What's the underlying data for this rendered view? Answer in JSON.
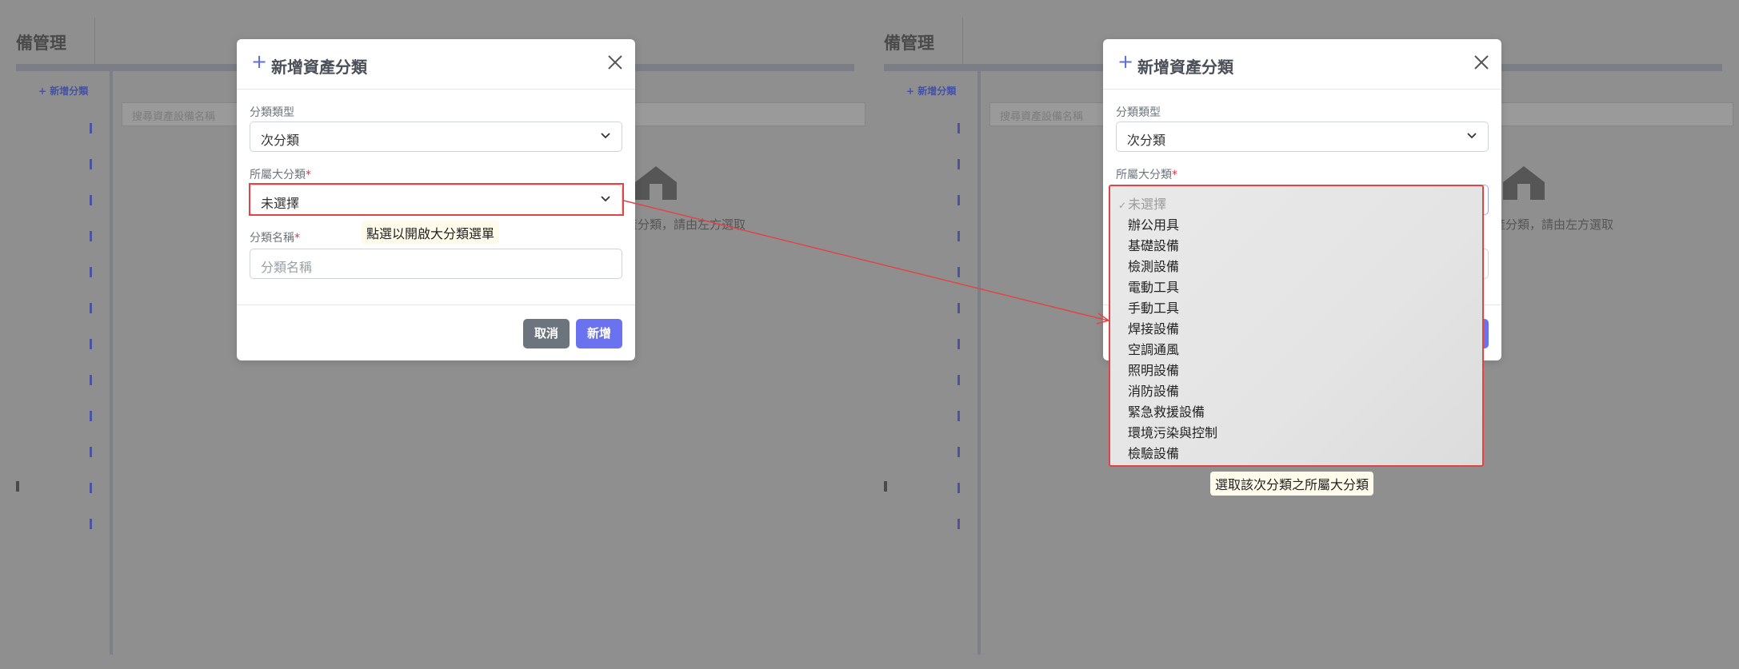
{
  "background_app": {
    "title": "備管理",
    "add_link": "+ 新增分類",
    "search_placeholder": "搜尋資產設備名稱",
    "empty_state_text": "產分類，請由左方選取"
  },
  "modal": {
    "title": "新增資產分類",
    "category_type_label": "分類類型",
    "category_type_value": "次分類",
    "parent_label": "所屬大分類",
    "parent_value": "未選擇",
    "name_label": "分類名稱",
    "name_placeholder": "分類名稱",
    "required_mark": "*",
    "cancel_label": "取消",
    "add_label": "新增"
  },
  "annotations": {
    "left_tooltip": "點選以開啟大分類選單",
    "right_tooltip": "選取該次分類之所屬大分類"
  },
  "dropdown": {
    "check_mark": "✓",
    "options": [
      "未選擇",
      "辦公用具",
      "基礎設備",
      "檢測設備",
      "電動工具",
      "手動工具",
      "焊接設備",
      "空調通風",
      "照明設備",
      "消防設備",
      "緊急救援設備",
      "環境污染與控制",
      "檢驗設備"
    ]
  },
  "colors": {
    "accent": "#6b72f0",
    "highlight": "#e04545",
    "cancel": "#6c757d",
    "tooltip_bg": "#fffbeb"
  },
  "icons": [
    "plus-icon",
    "close-icon",
    "chevron-down-icon",
    "home-icon",
    "check-icon"
  ]
}
